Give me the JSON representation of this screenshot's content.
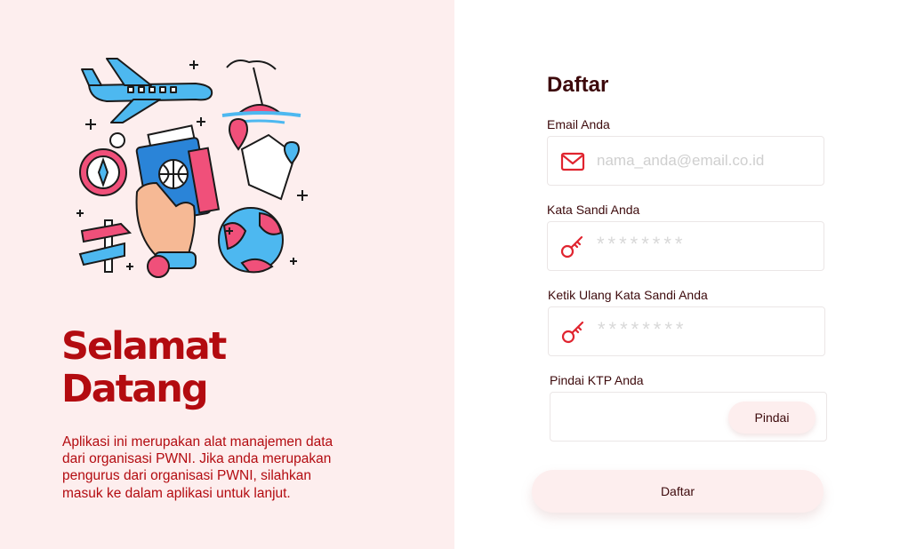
{
  "welcome": {
    "title": "Selamat\nDatang",
    "description": "Aplikasi ini merupakan alat manajemen data dari organisasi PWNI. Jika anda merupakan pengurus dari organisasi PWNI, silahkan masuk ke dalam aplikasi untuk lanjut."
  },
  "form": {
    "title": "Daftar",
    "email": {
      "label": "Email Anda",
      "placeholder": "nama_anda@email.co.id",
      "icon": "mail-icon"
    },
    "password": {
      "label": "Kata Sandi Anda",
      "placeholder": "********",
      "icon": "key-icon"
    },
    "confirm_password": {
      "label": "Ketik Ulang Kata Sandi Anda",
      "placeholder": "********",
      "icon": "key-icon"
    },
    "ktp": {
      "label": "Pindai KTP Anda",
      "button_label": "Pindai"
    },
    "submit_label": "Daftar"
  },
  "colors": {
    "accent": "#b30b10",
    "icon_red": "#e0242f",
    "left_bg": "#fdeeee",
    "dark_text": "#3d0a0c"
  }
}
